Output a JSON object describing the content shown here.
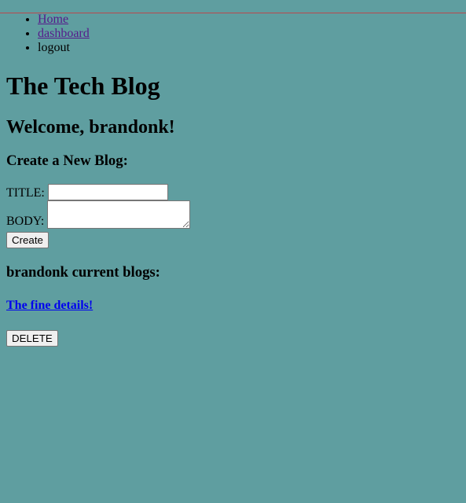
{
  "nav": {
    "items": [
      {
        "label": "Home"
      },
      {
        "label": "dashboard"
      },
      {
        "label": "logout"
      }
    ]
  },
  "header": {
    "title": "The Tech Blog"
  },
  "main": {
    "welcome": "Welcome, brandonk!",
    "create_heading": "Create a New Blog:",
    "form": {
      "title_label": "TITLE:",
      "title_value": "",
      "body_label": "BODY:",
      "body_value": "",
      "create_label": "Create"
    },
    "blogs_heading": "brandonk current blogs:",
    "blogs": [
      {
        "title": "The fine details!",
        "delete_label": "DELETE"
      }
    ]
  },
  "colors": {
    "background": "#5f9ea0",
    "visited_link": "#551a8b",
    "link": "#0000ee"
  }
}
